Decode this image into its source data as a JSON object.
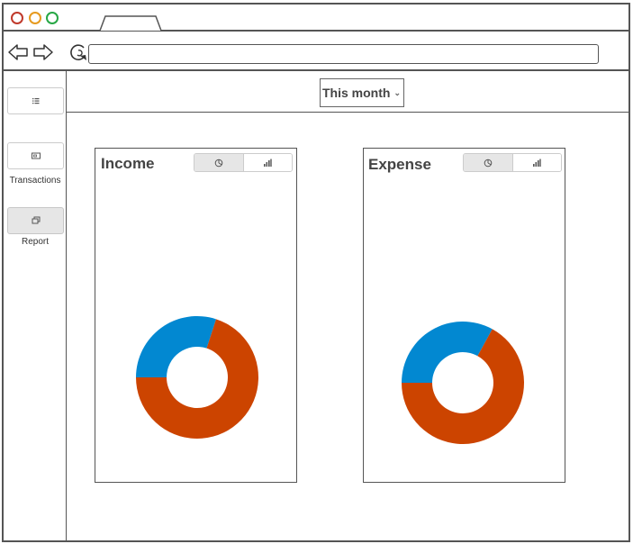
{
  "window": {
    "controls": [
      "close",
      "minimize",
      "maximize"
    ],
    "address": {
      "value": ""
    }
  },
  "sidebar": {
    "items": [
      {
        "icon": "list-icon",
        "label": ""
      },
      {
        "icon": "wallet-icon",
        "label": "Transactions"
      },
      {
        "icon": "report-icon",
        "label": "Report",
        "active": true
      }
    ]
  },
  "header": {
    "period": "This month",
    "period_chevron": "⌄"
  },
  "panels": {
    "income": {
      "title": "Income",
      "view_toggle": [
        "pie-chart-icon",
        "bar-chart-icon"
      ],
      "active_view": "pie"
    },
    "expense": {
      "title": "Expense",
      "view_toggle": [
        "pie-chart-icon",
        "bar-chart-icon"
      ],
      "active_view": "pie"
    }
  },
  "colors": {
    "blue": "#0288d1",
    "orange": "#cc4400",
    "border": "#555555",
    "active_bg": "#e6e6e6"
  },
  "chart_data": [
    {
      "type": "pie",
      "donut": true,
      "title": "",
      "slices": [
        {
          "label": "",
          "value": 30,
          "color": "#0288d1"
        },
        {
          "label": "",
          "value": 70,
          "color": "#cc4400"
        }
      ]
    },
    {
      "type": "pie",
      "donut": true,
      "title": "",
      "slices": [
        {
          "label": "",
          "value": 33,
          "color": "#0288d1"
        },
        {
          "label": "",
          "value": 67,
          "color": "#cc4400"
        }
      ]
    }
  ]
}
